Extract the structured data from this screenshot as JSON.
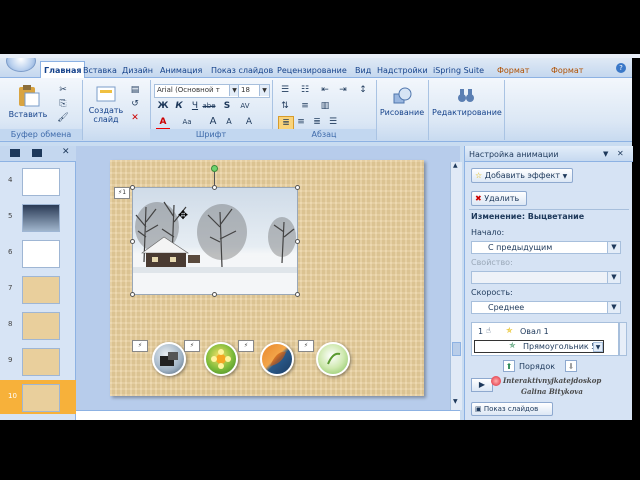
{
  "tabs": [
    "Главная",
    "Вставка",
    "Дизайн",
    "Анимация",
    "Показ слайдов",
    "Рецензирование",
    "Вид",
    "Надстройки",
    "iSpring Suite",
    "Формат",
    "Формат"
  ],
  "ribbon": {
    "clipboard": {
      "label": "Буфер обмена",
      "paste": "Вставить"
    },
    "slides": {
      "create": "Создать",
      "create2": "слайд"
    },
    "font": {
      "label": "Шрифт",
      "family": "Arial (Основной т",
      "size": "18",
      "bold": "Ж",
      "italic": "К",
      "underline": "Ч",
      "strike": "abe",
      "shadow": "S",
      "spacing": "AV",
      "case": "Aa",
      "grow": "A",
      "shrink": "A",
      "clear": "A"
    },
    "paragraph": {
      "label": "Абзац"
    },
    "drawing": {
      "label": "Рисование"
    },
    "editing": {
      "label": "Редактирование"
    }
  },
  "thumbs": [
    "4",
    "5",
    "6",
    "7",
    "8",
    "9",
    "10"
  ],
  "pane": {
    "title": "Настройка анимации",
    "add_effect": "Добавить эффект",
    "remove": "Удалить",
    "change": "Изменение: Выцветание",
    "start_label": "Начало:",
    "start_value": "С предыдущим",
    "property_label": "Свойство:",
    "speed_label": "Скорость:",
    "speed_value": "Среднее",
    "list_item1_num": "1",
    "list_item1": "Овал 1",
    "list_item2": "Прямоугольник 5",
    "order": "Порядок",
    "play": "Показ слайдов"
  },
  "watermark": {
    "line1": "Interaktivnyjkatejdoskop",
    "line2": "Galina Bitykova"
  },
  "colors": {
    "ribbon": "#dbe7f5",
    "selected_thumb": "#f7b13a",
    "slide_bg": "#e9cf9c"
  }
}
